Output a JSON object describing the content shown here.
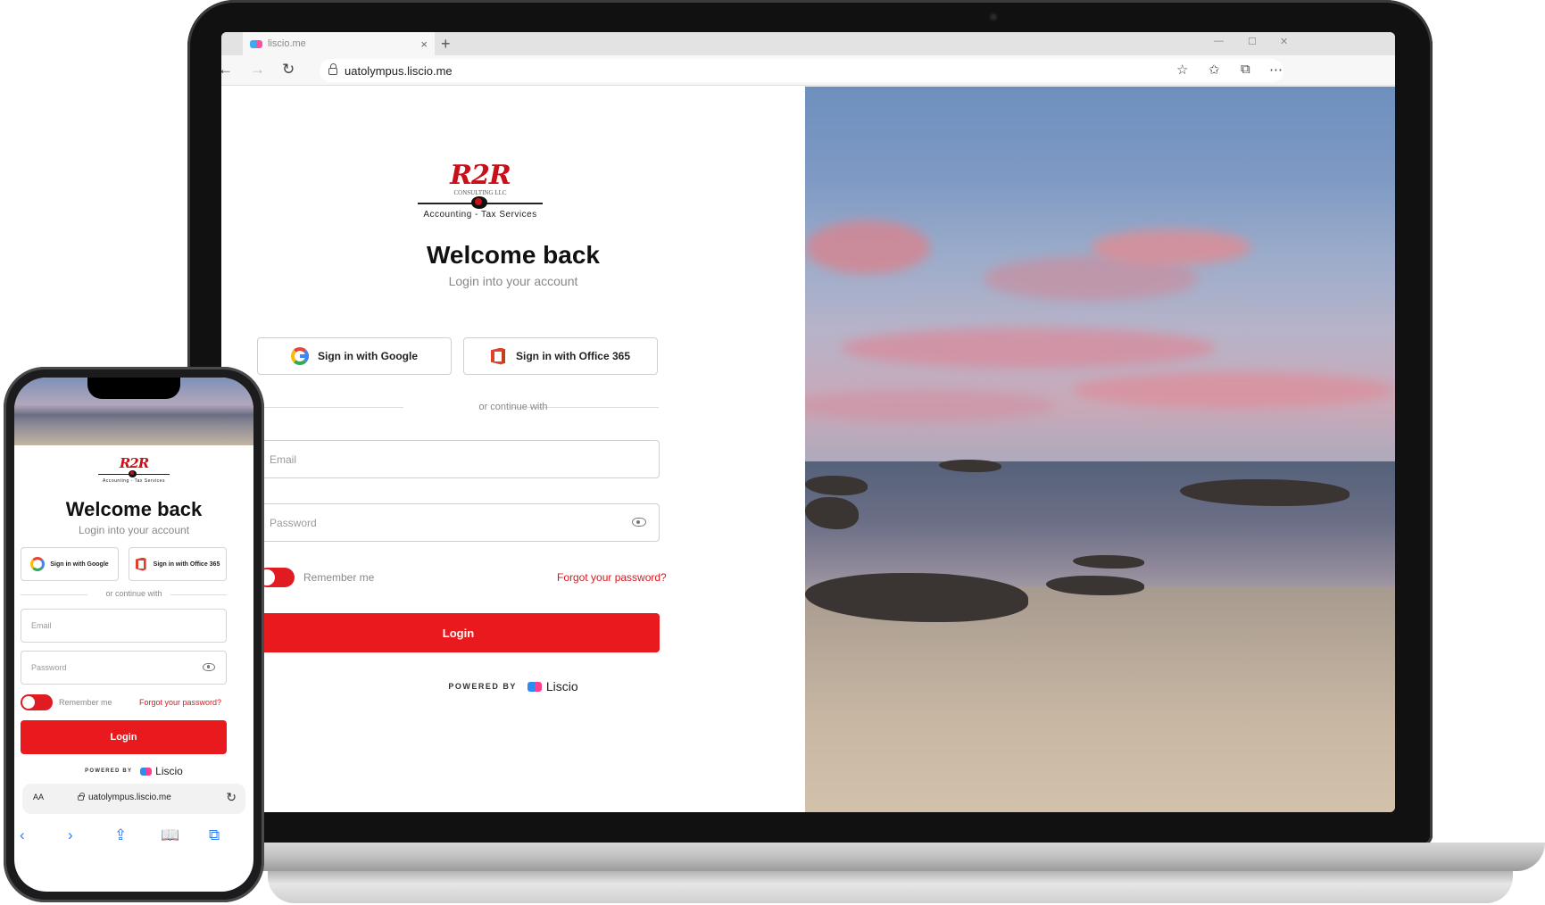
{
  "browser": {
    "tab_title": "liscio.me",
    "tab_close": "×",
    "new_tab": "+",
    "url": "uatolympus.liscio.me",
    "icons": [
      "back-arrow-icon",
      "forward-arrow-icon",
      "reload-icon",
      "favorite-add-icon",
      "favorites-icon",
      "collections-icon",
      "more-icon"
    ]
  },
  "login": {
    "logo_text": "R2R",
    "logo_subtext": "CONSULTING LLC",
    "logo_tagline": "Accounting - Tax Services",
    "title": "Welcome back",
    "subtitle": "Login into your account",
    "google_button": "Sign in with Google",
    "office_button": "Sign in with Office 365",
    "divider": "or continue with",
    "email_placeholder": "Email",
    "password_placeholder": "Password",
    "remember_me": "Remember me",
    "remember_me_on": true,
    "forgot_password": "Forgot your password?",
    "login_button": "Login",
    "powered_by": "POWERED BY",
    "brand": "Liscio"
  },
  "mobile": {
    "text_size": "AA",
    "url": "uatolympus.liscio.me",
    "toolbar_icons": [
      "back-icon",
      "forward-icon",
      "share-icon",
      "bookmarks-icon",
      "tabs-icon"
    ]
  },
  "colors": {
    "accent": "#e81a1d",
    "link": "#d81820"
  }
}
